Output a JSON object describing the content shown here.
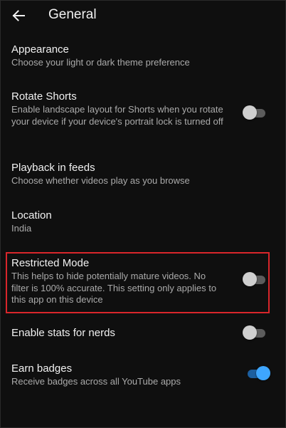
{
  "header": {
    "back_icon": "arrow-left-icon",
    "title": "General"
  },
  "settings": [
    {
      "id": "appearance",
      "title": "Appearance",
      "description": "Choose your light or dark theme preference"
    },
    {
      "id": "rotate-shorts",
      "title": "Rotate Shorts",
      "description": "Enable landscape layout for Shorts when you rotate your device if your device's portrait lock is turned off",
      "toggle": false
    },
    {
      "id": "playback-in-feeds",
      "title": "Playback in feeds",
      "description": "Choose whether videos play as you browse"
    },
    {
      "id": "location",
      "title": "Location",
      "description": "India"
    },
    {
      "id": "restricted-mode",
      "title": "Restricted Mode",
      "description": "This helps to hide potentially mature videos. No filter is 100% accurate. This setting only applies to this app on this device",
      "toggle": false,
      "highlighted": true
    },
    {
      "id": "stats-for-nerds",
      "title": "Enable stats for nerds",
      "toggle": false
    },
    {
      "id": "earn-badges",
      "title": "Earn badges",
      "description": "Receive badges across all YouTube apps",
      "toggle": true
    }
  ],
  "colors": {
    "background": "#0f0f0f",
    "text_primary": "#f1f1f1",
    "text_secondary": "#aaaaaa",
    "toggle_on": "#3ea6ff",
    "highlight_border": "#d9262b"
  }
}
